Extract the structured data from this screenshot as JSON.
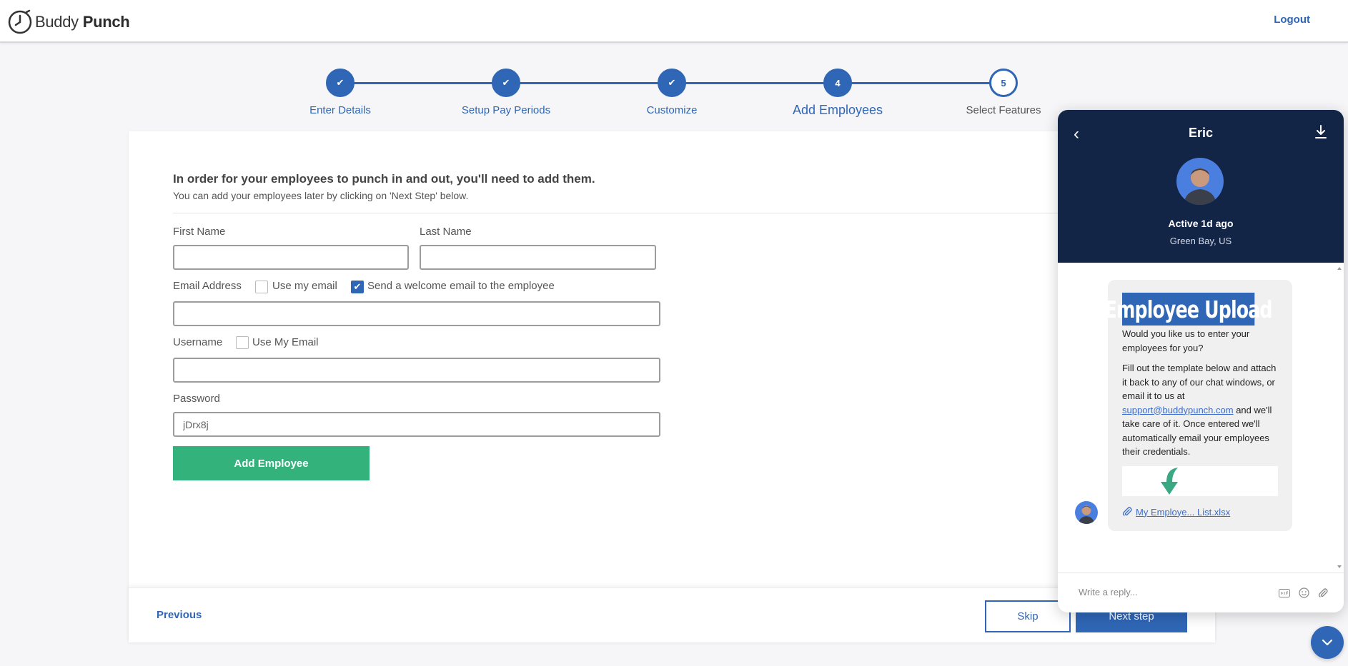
{
  "header": {
    "logo_word1": "Buddy",
    "logo_word2": "Punch",
    "logout_label": "Logout"
  },
  "stepper": {
    "steps": [
      {
        "label": "Enter Details",
        "marker": "✔",
        "state": "done"
      },
      {
        "label": "Setup Pay Periods",
        "marker": "✔",
        "state": "done"
      },
      {
        "label": "Customize",
        "marker": "✔",
        "state": "done"
      },
      {
        "label": "Add Employees",
        "marker": "4",
        "state": "current"
      },
      {
        "label": "Select Features",
        "marker": "5",
        "state": "pending"
      }
    ]
  },
  "form": {
    "title": "In order for your employees to punch in and out, you'll need to add them.",
    "subtitle": "You can add your employees later by clicking on 'Next Step' below.",
    "first_name_label": "First Name",
    "first_name_value": "",
    "last_name_label": "Last Name",
    "last_name_value": "",
    "email_label": "Email Address",
    "use_my_email_label": "Use my email",
    "use_my_email_checked": false,
    "send_welcome_label": "Send a welcome email to the employee",
    "send_welcome_checked": true,
    "email_value": "",
    "username_label": "Username",
    "use_my_email_username_label": "Use My Email",
    "use_my_email_username_checked": false,
    "username_value": "",
    "password_label": "Password",
    "password_value": "jDrx8j",
    "add_button_label": "Add Employee"
  },
  "footer": {
    "previous_label": "Previous",
    "skip_label": "Skip",
    "next_label": "Next step"
  },
  "chat": {
    "agent_name": "Eric",
    "status": "Active 1d ago",
    "location": "Green Bay, US",
    "banner_text": "Employee Upload",
    "question": "Would you like us to enter your employees for you?",
    "body_before_link": "Fill out the template below and attach it back to any of our chat windows, or email it to us at ",
    "email_link": "support@buddypunch.com",
    "body_after_link": " and we'll take care of it.  Once entered we'll automatically email your employees their credentials.",
    "attachment_name": "My Employe... List.xlsx",
    "reply_placeholder": "Write a reply..."
  },
  "colors": {
    "brand_blue": "#2f66b5",
    "green": "#34b27b",
    "chat_header": "#122547"
  }
}
